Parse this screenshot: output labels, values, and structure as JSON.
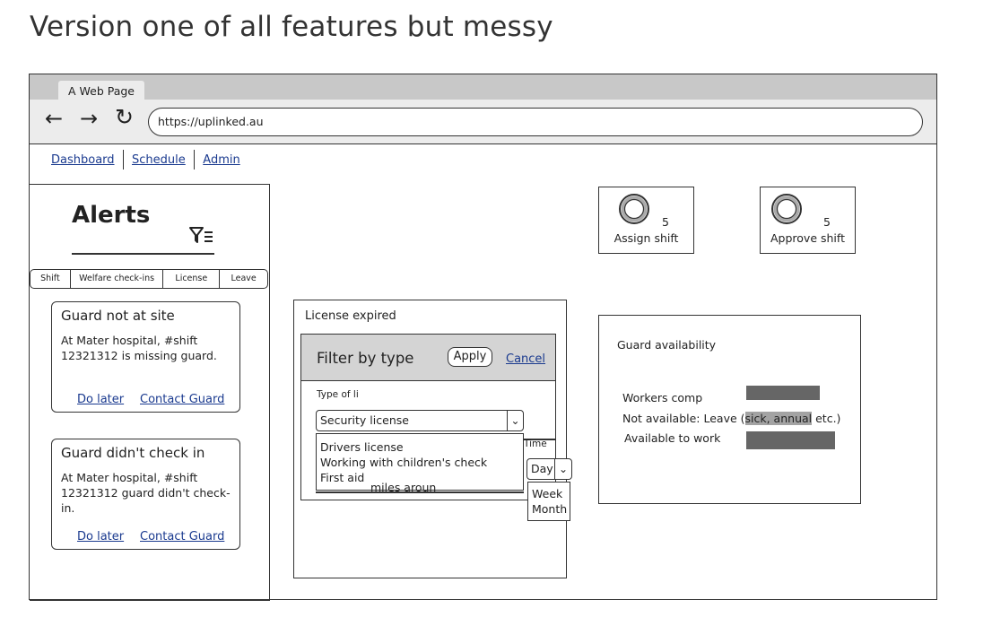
{
  "page_title": "Version one of all features but messy",
  "browser": {
    "tab_label": "A Web Page",
    "url": "https://uplinked.au",
    "back_icon": "←",
    "forward_icon": "→",
    "reload_icon": "↻"
  },
  "nav": {
    "links": [
      "Dashboard",
      "Schedule",
      "Admin"
    ]
  },
  "alerts": {
    "title": "Alerts",
    "tabs": [
      "Shift",
      "Welfare check-ins",
      "License",
      "Leave"
    ],
    "cards": [
      {
        "title": "Guard not at site",
        "body": "At Mater hospital, #shift 12321312 is missing guard.",
        "action_later": "Do later",
        "action_contact": "Contact Guard"
      },
      {
        "title": "Guard didn't check in",
        "body": "At Mater hospital, #shift 12321312 guard didn't check-in.",
        "action_later": "Do later",
        "action_contact": "Contact Guard"
      }
    ]
  },
  "license_panel": {
    "title": "License expired",
    "filter_dialog": {
      "title": "Filter by type",
      "apply_label": "Apply",
      "cancel_label": "Cancel",
      "type_label": "Type of li",
      "selected": "Security license",
      "options": [
        "Drivers license",
        "Working with children's check",
        "First aid"
      ],
      "behind_text": "miles aroun",
      "time_label": "Time"
    },
    "time_select": {
      "selected": "Day",
      "options": [
        "Week",
        "Month"
      ]
    }
  },
  "widgets": [
    {
      "count": "5",
      "label": "Assign shift"
    },
    {
      "count": "5",
      "label": "Approve shift"
    }
  ],
  "availability": {
    "title": "Guard availability",
    "rows": [
      {
        "label": "Workers comp"
      },
      {
        "label_prefix": "Not available: Leave (",
        "label_highlight": "sick, annual",
        "label_suffix": " etc.)"
      },
      {
        "label": "Available to work"
      }
    ]
  }
}
